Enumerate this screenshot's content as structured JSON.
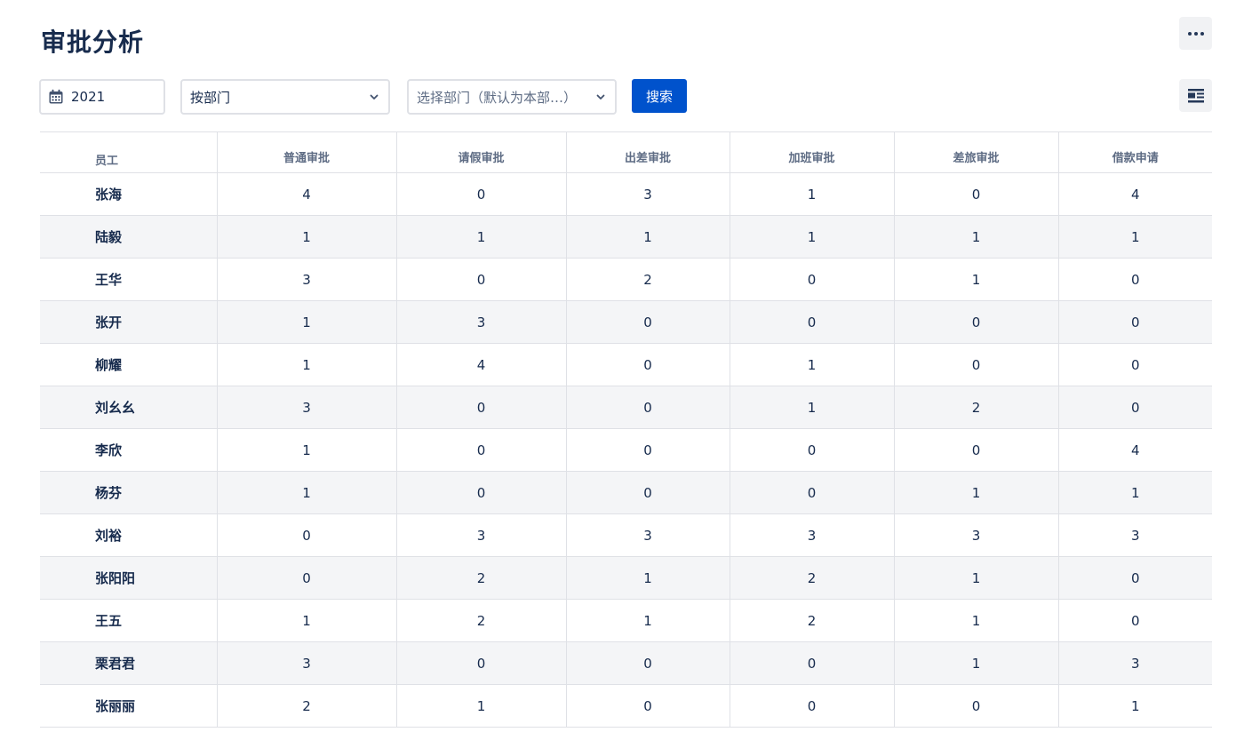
{
  "page": {
    "title": "审批分析"
  },
  "toolbar": {
    "year": "2021",
    "group_by": "按部门",
    "department_placeholder": "选择部门（默认为本部…）",
    "search_label": "搜索"
  },
  "table": {
    "columns": [
      "员工",
      "普通审批",
      "请假审批",
      "出差审批",
      "加班审批",
      "差旅审批",
      "借款申请"
    ],
    "rows": [
      [
        "张海",
        "4",
        "0",
        "3",
        "1",
        "0",
        "4"
      ],
      [
        "陆毅",
        "1",
        "1",
        "1",
        "1",
        "1",
        "1"
      ],
      [
        "王华",
        "3",
        "0",
        "2",
        "0",
        "1",
        "0"
      ],
      [
        "张开",
        "1",
        "3",
        "0",
        "0",
        "0",
        "0"
      ],
      [
        "柳耀",
        "1",
        "4",
        "0",
        "1",
        "0",
        "0"
      ],
      [
        "刘幺幺",
        "3",
        "0",
        "0",
        "1",
        "2",
        "0"
      ],
      [
        "李欣",
        "1",
        "0",
        "0",
        "0",
        "0",
        "4"
      ],
      [
        "杨芬",
        "1",
        "0",
        "0",
        "0",
        "1",
        "1"
      ],
      [
        "刘裕",
        "0",
        "3",
        "3",
        "3",
        "3",
        "3"
      ],
      [
        "张阳阳",
        "0",
        "2",
        "1",
        "2",
        "1",
        "0"
      ],
      [
        "王五",
        "1",
        "2",
        "1",
        "2",
        "1",
        "0"
      ],
      [
        "栗君君",
        "3",
        "0",
        "0",
        "0",
        "1",
        "3"
      ],
      [
        "张丽丽",
        "2",
        "1",
        "0",
        "0",
        "0",
        "1"
      ]
    ]
  },
  "icons": {
    "more": "more-horizontal-icon",
    "calendar": "calendar-icon",
    "chevron": "chevron-down-icon",
    "layout": "table-layout-icon"
  },
  "colors": {
    "primary": "#0052cc",
    "text": "#172b4d",
    "muted": "#5e6c84",
    "stripe": "#f4f5f7",
    "border": "#dfe1e6"
  }
}
